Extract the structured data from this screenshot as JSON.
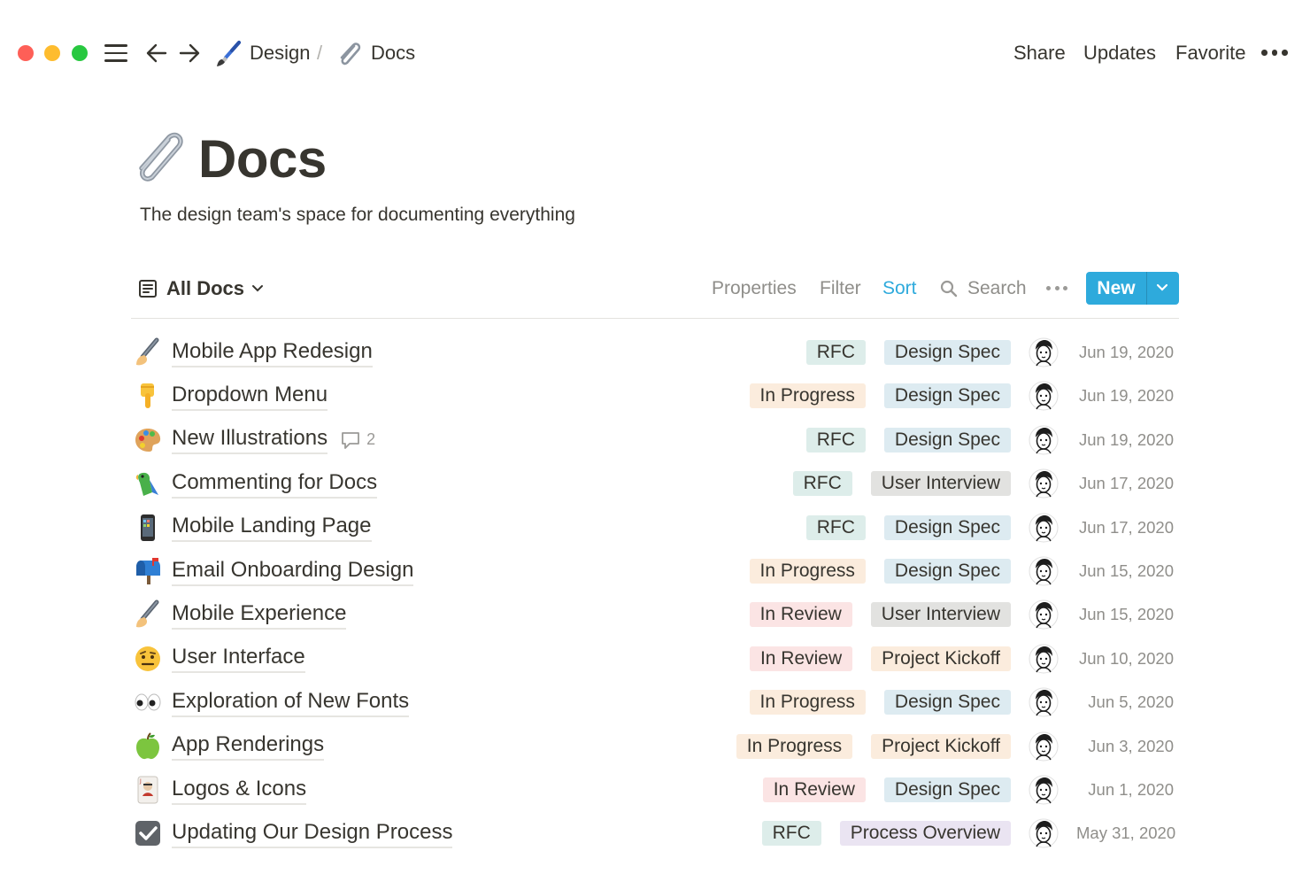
{
  "topbar": {
    "breadcrumb": [
      {
        "label": "Design",
        "icon": "paintbrush-icon"
      },
      {
        "label": "Docs",
        "icon": "paperclip-icon"
      }
    ],
    "separator": "/",
    "actions": [
      "Share",
      "Updates",
      "Favorite"
    ]
  },
  "page": {
    "title": "Docs",
    "icon": "paperclip-icon",
    "description": "The design team's space for documenting everything"
  },
  "view": {
    "name": "All Docs",
    "toolbar": {
      "properties": "Properties",
      "filter": "Filter",
      "sort": "Sort",
      "search": "Search",
      "new": "New"
    }
  },
  "colors": {
    "accent": "#2eaadc",
    "tag_RFC": "#ddedea",
    "tag_in_progress": "#fbecdd",
    "tag_in_review": "#fbe4e4",
    "tag_design_spec": "#ddebf1",
    "tag_user_interview": "#e2e2e0",
    "tag_project_kickoff": "#fbecdd",
    "tag_process_overview": "#eae4f2"
  },
  "docs": [
    {
      "title": "Mobile App Redesign",
      "icon": "phone-hand-icon",
      "status": "RFC",
      "type": "Design Spec",
      "date": "Jun 19, 2020"
    },
    {
      "title": "Dropdown Menu",
      "icon": "pointing-down-icon",
      "status": "In Progress",
      "type": "Design Spec",
      "date": "Jun 19, 2020"
    },
    {
      "title": "New Illustrations",
      "icon": "palette-icon",
      "status": "RFC",
      "type": "Design Spec",
      "date": "Jun 19, 2020",
      "comments": "2"
    },
    {
      "title": "Commenting for Docs",
      "icon": "parrot-icon",
      "status": "RFC",
      "type": "User Interview",
      "date": "Jun 17, 2020"
    },
    {
      "title": "Mobile Landing Page",
      "icon": "mobile-phone-icon",
      "status": "RFC",
      "type": "Design Spec",
      "date": "Jun 17, 2020"
    },
    {
      "title": "Email Onboarding Design",
      "icon": "mailbox-icon",
      "status": "In Progress",
      "type": "Design Spec",
      "date": "Jun 15, 2020"
    },
    {
      "title": "Mobile Experience",
      "icon": "phone-hand-icon",
      "status": "In Review",
      "type": "User Interview",
      "date": "Jun 15, 2020"
    },
    {
      "title": "User Interface",
      "icon": "raised-eyebrow-icon",
      "status": "In Review",
      "type": "Project Kickoff",
      "date": "Jun 10, 2020"
    },
    {
      "title": "Exploration of New Fonts",
      "icon": "eyes-icon",
      "status": "In Progress",
      "type": "Design Spec",
      "date": "Jun 5, 2020"
    },
    {
      "title": "App Renderings",
      "icon": "green-apple-icon",
      "status": "In Progress",
      "type": "Project Kickoff",
      "date": "Jun 3, 2020"
    },
    {
      "title": "Logos & Icons",
      "icon": "playing-card-icon",
      "status": "In Review",
      "type": "Design Spec",
      "date": "Jun 1, 2020"
    },
    {
      "title": "Updating Our Design Process",
      "icon": "checkbox-icon",
      "status": "RFC",
      "type": "Process Overview",
      "date": "May 31, 2020"
    }
  ]
}
